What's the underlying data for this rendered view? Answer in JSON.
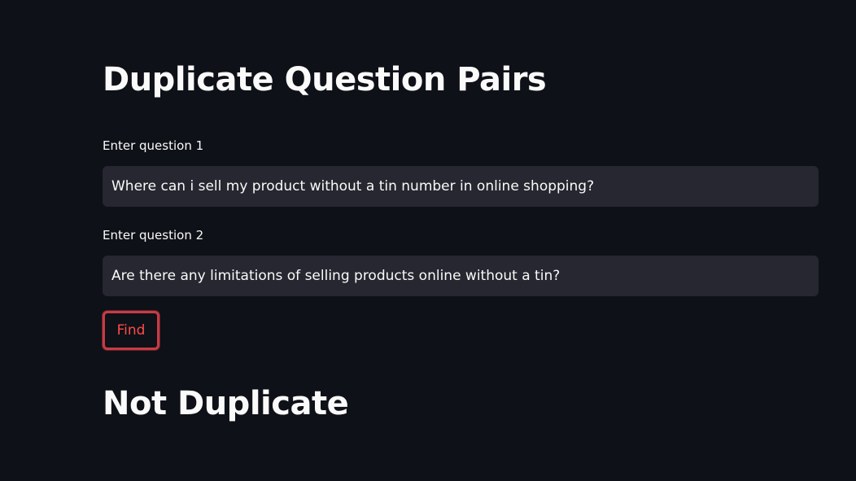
{
  "page": {
    "title": "Duplicate Question Pairs"
  },
  "form": {
    "question1": {
      "label": "Enter question 1",
      "value": "Where can i sell my product without a tin number in online shopping?"
    },
    "question2": {
      "label": "Enter question 2",
      "value": "Are there any limitations of selling products online without a tin?"
    },
    "find_label": "Find"
  },
  "result": {
    "text": "Not Duplicate"
  },
  "colors": {
    "background": "#0e1117",
    "input_background": "#262730",
    "accent": "#ff4b4b",
    "text": "#fafafa"
  }
}
